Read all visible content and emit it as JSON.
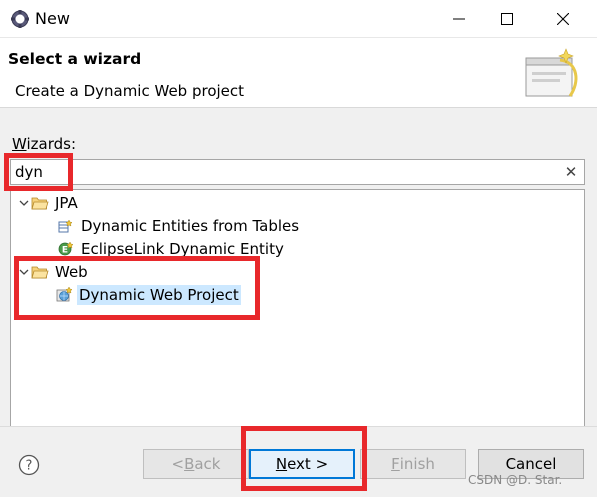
{
  "window": {
    "title": "New"
  },
  "header": {
    "title": "Select a wizard",
    "description": "Create a Dynamic Web project"
  },
  "wizards": {
    "label_prefix": "",
    "label_accel": "W",
    "label_rest": "izards:",
    "filter_value": "dyn",
    "clear_icon": "clear-icon"
  },
  "tree": {
    "items": [
      {
        "label": "JPA",
        "type": "folder",
        "expanded": true,
        "depth": 0
      },
      {
        "label": "Dynamic Entities from Tables",
        "type": "item",
        "depth": 1,
        "icon": "entities-icon"
      },
      {
        "label": "EclipseLink Dynamic Entity",
        "type": "item",
        "depth": 1,
        "icon": "eclipselink-icon"
      },
      {
        "label": "Web",
        "type": "folder",
        "expanded": true,
        "depth": 0
      },
      {
        "label": "Dynamic Web Project",
        "type": "item",
        "depth": 1,
        "selected": true,
        "icon": "web-project-icon"
      }
    ]
  },
  "buttons": {
    "back_prefix": "< ",
    "back_accel": "B",
    "back_rest": "ack",
    "next_accel": "N",
    "next_rest": "ext >",
    "finish_accel": "F",
    "finish_rest": "inish",
    "cancel": "Cancel"
  },
  "watermark": "CSDN @D. Star.",
  "colors": {
    "highlight": "#e8282b",
    "selection": "#cce8ff",
    "default_button_border": "#0078d7"
  }
}
